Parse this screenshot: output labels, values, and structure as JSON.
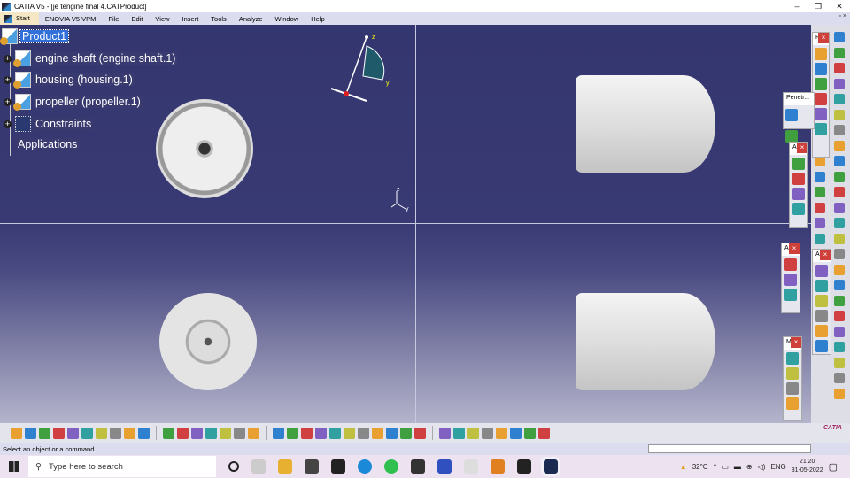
{
  "window": {
    "title": "CATIA V5 - [je tengine final 4.CATProduct]",
    "controls": [
      "–",
      "❐",
      "✕"
    ]
  },
  "menu": {
    "items": [
      "Start",
      "ENOVIA V5 VPM",
      "File",
      "Edit",
      "View",
      "Insert",
      "Tools",
      "Analyze",
      "Window",
      "Help"
    ],
    "doc_controls": "_ ▫ ×"
  },
  "tree": {
    "root": "Product1",
    "children": [
      {
        "label": "engine shaft (engine shaft.1)",
        "icon": "part-icon"
      },
      {
        "label": "housing (housing.1)",
        "icon": "part-icon"
      },
      {
        "label": "propeller (propeller.1)",
        "icon": "part-icon"
      },
      {
        "label": "Constraints",
        "icon": "constraints-icon"
      },
      {
        "label": "Applications",
        "icon": "none"
      }
    ]
  },
  "compass": {
    "axes": [
      "z",
      "y"
    ]
  },
  "axis_triad": {
    "axes": [
      "z",
      "y"
    ]
  },
  "floating_toolbars": [
    {
      "title": "P",
      "icons": 6
    },
    {
      "title": "Penetr...",
      "icons": 2
    },
    {
      "title": "A",
      "icons": 4
    },
    {
      "title": "A",
      "icons": 3
    },
    {
      "title": "A",
      "icons": 6
    },
    {
      "title": "M",
      "icons": 4
    }
  ],
  "status": {
    "message": "Select an object or a command",
    "command_input": ""
  },
  "bottom_toolbar": {
    "icons": [
      "new-icon",
      "open-icon",
      "save-icon",
      "print-icon",
      "cut-icon",
      "copy-icon",
      "paste-icon",
      "undo-icon",
      "redo-icon",
      "whats-this-icon",
      "formula-icon",
      "comment-icon",
      "link-icon",
      "table-icon",
      "tree-icon",
      "lock-icon",
      "parameters-icon",
      "fly-icon",
      "fit-all-icon",
      "pan-icon",
      "rotate-icon",
      "zoom-in-icon",
      "zoom-out-icon",
      "normal-view-icon",
      "multi-view-icon",
      "iso-view-icon",
      "shading-icon",
      "hide-show-icon",
      "swap-icon",
      "catalog-icon",
      "scene-icon",
      "render-icon",
      "measure-icon",
      "snap-icon",
      "tool-icon",
      "material-icon"
    ],
    "brand": "CATIA"
  },
  "taskbar": {
    "search_placeholder": "Type here to search",
    "weather": "32°C",
    "language": "ENG",
    "time": "21:20",
    "date": "31-05-2022"
  },
  "colors": {
    "viewport_top": "#343670",
    "viewport_bottom": "#b4b4cc",
    "selection": "#3070d8",
    "close_button": "#d0403a"
  }
}
